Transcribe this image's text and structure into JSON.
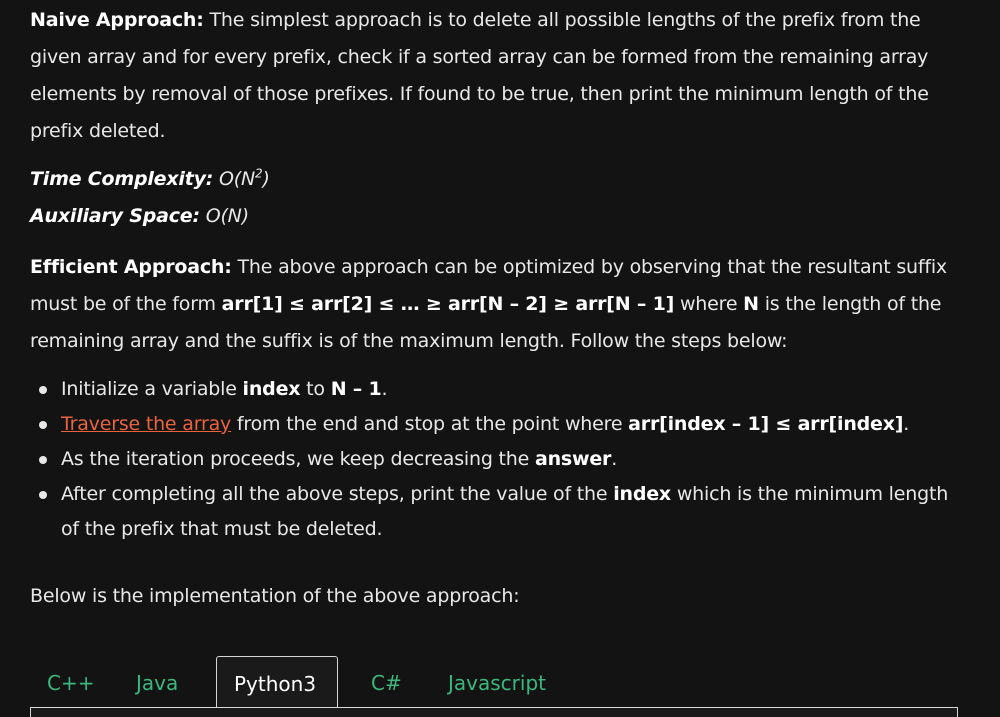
{
  "naive": {
    "heading": "Naive Approach:",
    "text": " The simplest approach is to delete all possible lengths of the prefix from the given array and for every prefix, check if a sorted array can be formed from the remaining array elements by removal of those prefixes. If found to be true, then print the minimum length of the prefix deleted."
  },
  "complexity": {
    "time_label": "Time Complexity:",
    "time_value_base": " O(N",
    "time_value_exp": "2",
    "time_value_end": ")",
    "space_label": "Auxiliary Space:",
    "space_value": " O(N)"
  },
  "efficient": {
    "heading": "Efficient Approach:",
    "text1": " The above approach can be optimized by observing that the resultant suffix must be of the form ",
    "form": "arr[1] ≤ arr[2] ≤ … ≥ arr[N – 2] ≥ arr[N – 1]",
    "text2": " where ",
    "n": "N",
    "text3": " is the length of the remaining array and the suffix is of the maximum length. Follow the steps below:"
  },
  "steps": [
    {
      "pre": "Initialize a variable ",
      "bold": "index",
      "mid": " to ",
      "bold2": "N – 1",
      "post": "."
    },
    {
      "link": "Traverse the array",
      "pre": " from the end and stop at the point where ",
      "bold": "arr[index – 1] ≤ arr[index]",
      "post": "."
    },
    {
      "pre": "As the iteration proceeds, we keep decreasing the ",
      "bold": "answer",
      "post": "."
    },
    {
      "pre": "After completing all the above steps, print the value of the ",
      "bold": "index",
      "post": " which is the minimum length of the prefix that must be deleted."
    }
  ],
  "below_text": "Below is the implementation of the above approach:",
  "tabs": [
    "C++",
    "Java",
    "Python3",
    "C#",
    "Javascript"
  ],
  "active_tab": "Python3",
  "colors": {
    "background": "#131313",
    "text": "#e8e8e8",
    "link": "#e8643d",
    "tab_text": "#3bb77e"
  }
}
